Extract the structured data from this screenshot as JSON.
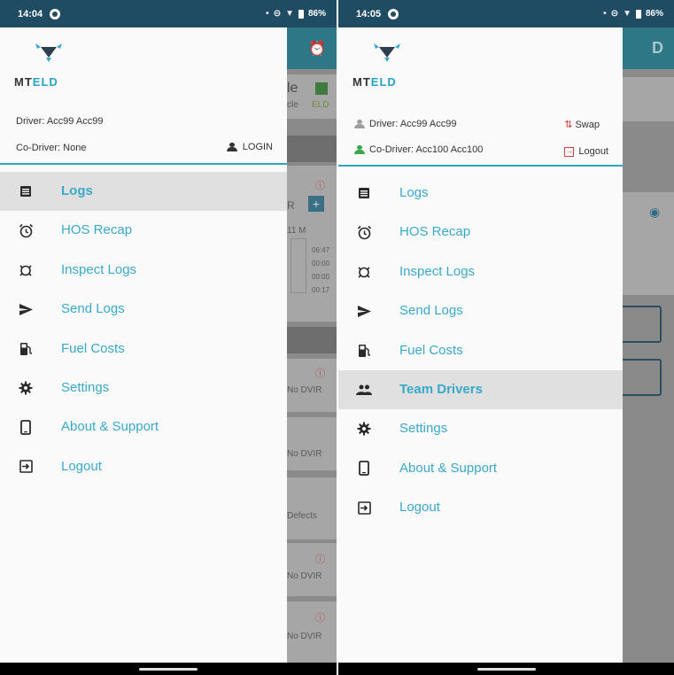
{
  "screens": [
    {
      "status": {
        "time": "14:04",
        "battery": "86%"
      },
      "brand": {
        "prefix": "MT",
        "accent": "ELD"
      },
      "driver_text": "Driver: Acc99 Acc99",
      "codriver_text": "Co-Driver: None",
      "login_label": "LOGIN",
      "menu": [
        {
          "label": "Logs",
          "icon": "list-icon",
          "selected": true
        },
        {
          "label": "HOS Recap",
          "icon": "alarm-clock-icon",
          "selected": false
        },
        {
          "label": "Inspect Logs",
          "icon": "inspection-icon",
          "selected": false
        },
        {
          "label": "Send Logs",
          "icon": "send-icon",
          "selected": false
        },
        {
          "label": "Fuel Costs",
          "icon": "fuel-pump-icon",
          "selected": false
        },
        {
          "label": "Settings",
          "icon": "gear-icon",
          "selected": false
        },
        {
          "label": "About & Support",
          "icon": "phone-icon",
          "selected": false
        },
        {
          "label": "Logout",
          "icon": "logout-icon",
          "selected": false
        }
      ],
      "background": {
        "vehicle_partial": "le",
        "vehicle_sub": "cle",
        "eld_label": "ELD",
        "hours_label": "11 M",
        "times": [
          "06:47",
          "00:00",
          "00:00",
          "00:17"
        ],
        "r_label": "R",
        "dvir_rows": [
          "No DVIR",
          "No DVIR",
          "Defects",
          "No DVIR",
          "No DVIR"
        ]
      }
    },
    {
      "status": {
        "time": "14:05",
        "battery": "86%"
      },
      "brand": {
        "prefix": "MT",
        "accent": "ELD"
      },
      "driver_text": "Driver: Acc99 Acc99",
      "codriver_text": "Co-Driver: Acc100 Acc100",
      "swap_label": "Swap",
      "logout_label": "Logout",
      "menu": [
        {
          "label": "Logs",
          "icon": "list-icon",
          "selected": false
        },
        {
          "label": "HOS Recap",
          "icon": "alarm-clock-icon",
          "selected": false
        },
        {
          "label": "Inspect Logs",
          "icon": "inspection-icon",
          "selected": false
        },
        {
          "label": "Send Logs",
          "icon": "send-icon",
          "selected": false
        },
        {
          "label": "Fuel Costs",
          "icon": "fuel-pump-icon",
          "selected": false
        },
        {
          "label": "Team Drivers",
          "icon": "team-icon",
          "selected": true
        },
        {
          "label": "Settings",
          "icon": "gear-icon",
          "selected": false
        },
        {
          "label": "About & Support",
          "icon": "phone-icon",
          "selected": false
        },
        {
          "label": "Logout",
          "icon": "logout-icon",
          "selected": false
        }
      ],
      "background": {
        "appbar_letter": "D"
      }
    }
  ],
  "colors": {
    "statusbar": "#1f4c63",
    "accent": "#39a9c9",
    "divider": "#2aa7c9",
    "selected_bg": "#e0e0e0",
    "green_user": "#3aa84a",
    "red_action": "#d23b3b"
  }
}
